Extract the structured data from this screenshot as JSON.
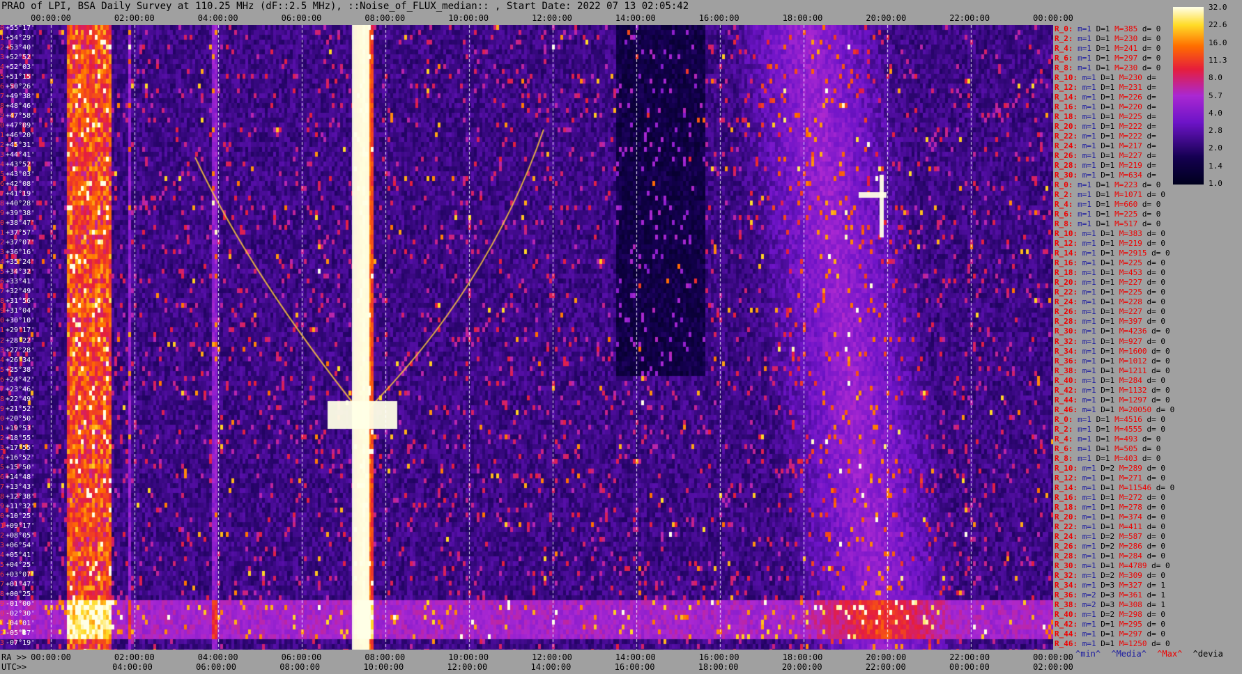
{
  "header": {
    "title": "PRAO of LPI, BSA Daily Survey at 110.25 MHz (dF::2.5 MHz), ::Noise_of_FLUX_median:: , Start Date: 2022 07 13 02:05:42"
  },
  "top_axis": {
    "labels": [
      "00:00:00",
      "02:00:00",
      "04:00:00",
      "06:00:00",
      "08:00:00",
      "10:00:00",
      "12:00:00",
      "14:00:00",
      "16:00:00",
      "18:00:00",
      "20:00:00",
      "22:00:00",
      "00:00:00"
    ]
  },
  "bottom_axis": {
    "ra_prefix": "RA >>",
    "ra_labels": [
      "00:00:00",
      "02:00:00",
      "04:00:00",
      "06:00:00",
      "08:00:00",
      "10:00:00",
      "12:00:00",
      "14:00:00",
      "16:00:00",
      "18:00:00",
      "20:00:00",
      "22:00:00",
      "00:00:00"
    ],
    "utc_prefix": "UTC>>",
    "utc_labels": [
      "04:00:00",
      "06:00:00",
      "08:00:00",
      "10:00:00",
      "12:00:00",
      "14:00:00",
      "16:00:00",
      "18:00:00",
      "20:00:00",
      "22:00:00",
      "00:00:00",
      "02:00:00"
    ]
  },
  "declination_labels": [
    "+55°17'",
    "+54°29'",
    "+53°40'",
    "+52°52'",
    "+52°03'",
    "+51°15'",
    "+50°26'",
    "+49°38'",
    "+48°46'",
    "+47°58'",
    "+47°09'",
    "+46°20'",
    "+45°31'",
    "+44°41'",
    "+43°52'",
    "+43°03'",
    "+42°08'",
    "+41°19'",
    "+40°28'",
    "+39°38'",
    "+38°47'",
    "+37°57'",
    "+37°07'",
    "+36°16'",
    "+35°24'",
    "+34°32'",
    "+33°41'",
    "+32°49'",
    "+31°56'",
    "+31°04'",
    "+30°10'",
    "+29°17'",
    "+28°22'",
    "+27°28'",
    "+26°34'",
    "+25°38'",
    "+24°42'",
    "+23°46'",
    "+22°49'",
    "+21°52'",
    "+20°50'",
    "+19°53'",
    "+18°55'",
    "+17°55'",
    "+16°52'",
    "+15°50'",
    "+14°48'",
    "+13°43'",
    "+12°38'",
    "+11°32'",
    "+10°25'",
    "+09°17'",
    "+08°05'",
    "+06°54'",
    "+05°41'",
    "+04°25'",
    "+03°07'",
    "+01°47'",
    "+00°25'",
    "-01°00'",
    "-02°30'",
    "-04°01'",
    "-05°37'",
    "-07°19'"
  ],
  "side_stats": [
    {
      "r": "R_0:",
      "m": "m=1",
      "d": "D=1",
      "M": "M=385",
      "dd": "d= 0"
    },
    {
      "r": "R_2:",
      "m": "m=1",
      "d": "D=1",
      "M": "M=230",
      "dd": "d= 0"
    },
    {
      "r": "R_4:",
      "m": "m=1",
      "d": "D=1",
      "M": "M=241",
      "dd": "d= 0"
    },
    {
      "r": "R_6:",
      "m": "m=1",
      "d": "D=1",
      "M": "M=297",
      "dd": "d= 0"
    },
    {
      "r": "R_8:",
      "m": "m=1",
      "d": "D=1",
      "M": "M=230",
      "dd": "d= 0"
    },
    {
      "r": "R_10:",
      "m": "m=1",
      "d": "D=1",
      "M": "M=230",
      "dd": "d="
    },
    {
      "r": "R_12:",
      "m": "m=1",
      "d": "D=1",
      "M": "M=231",
      "dd": "d="
    },
    {
      "r": "R_14:",
      "m": "m=1",
      "d": "D=1",
      "M": "M=226",
      "dd": "d="
    },
    {
      "r": "R_16:",
      "m": "m=1",
      "d": "D=1",
      "M": "M=220",
      "dd": "d="
    },
    {
      "r": "R_18:",
      "m": "m=1",
      "d": "D=1",
      "M": "M=225",
      "dd": "d="
    },
    {
      "r": "R_20:",
      "m": "m=1",
      "d": "D=1",
      "M": "M=222",
      "dd": "d="
    },
    {
      "r": "R_22:",
      "m": "m=1",
      "d": "D=1",
      "M": "M=222",
      "dd": "d="
    },
    {
      "r": "R_24:",
      "m": "m=1",
      "d": "D=1",
      "M": "M=217",
      "dd": "d="
    },
    {
      "r": "R_26:",
      "m": "m=1",
      "d": "D=1",
      "M": "M=227",
      "dd": "d="
    },
    {
      "r": "R_28:",
      "m": "m=1",
      "d": "D=1",
      "M": "M=219",
      "dd": "d="
    },
    {
      "r": "R_30:",
      "m": "m=1",
      "d": "D=1",
      "M": "M=634",
      "dd": "d="
    },
    {
      "r": "R_0:",
      "m": "m=1",
      "d": "D=1",
      "M": "M=223",
      "dd": "d= 0"
    },
    {
      "r": "R_2:",
      "m": "m=1",
      "d": "D=1",
      "M": "M=1071",
      "dd": "d= 0"
    },
    {
      "r": "R_4:",
      "m": "m=1",
      "d": "D=1",
      "M": "M=660",
      "dd": "d= 0"
    },
    {
      "r": "R_6:",
      "m": "m=1",
      "d": "D=1",
      "M": "M=225",
      "dd": "d= 0"
    },
    {
      "r": "R_8:",
      "m": "m=1",
      "d": "D=1",
      "M": "M=517",
      "dd": "d= 0"
    },
    {
      "r": "R_10:",
      "m": "m=1",
      "d": "D=1",
      "M": "M=383",
      "dd": "d= 0"
    },
    {
      "r": "R_12:",
      "m": "m=1",
      "d": "D=1",
      "M": "M=219",
      "dd": "d= 0"
    },
    {
      "r": "R_14:",
      "m": "m=1",
      "d": "D=1",
      "M": "M=2915",
      "dd": "d= 0"
    },
    {
      "r": "R_16:",
      "m": "m=1",
      "d": "D=1",
      "M": "M=225",
      "dd": "d= 0"
    },
    {
      "r": "R_18:",
      "m": "m=1",
      "d": "D=1",
      "M": "M=453",
      "dd": "d= 0"
    },
    {
      "r": "R_20:",
      "m": "m=1",
      "d": "D=1",
      "M": "M=227",
      "dd": "d= 0"
    },
    {
      "r": "R_22:",
      "m": "m=1",
      "d": "D=1",
      "M": "M=225",
      "dd": "d= 0"
    },
    {
      "r": "R_24:",
      "m": "m=1",
      "d": "D=1",
      "M": "M=228",
      "dd": "d= 0"
    },
    {
      "r": "R_26:",
      "m": "m=1",
      "d": "D=1",
      "M": "M=227",
      "dd": "d= 0"
    },
    {
      "r": "R_28:",
      "m": "m=1",
      "d": "D=1",
      "M": "M=397",
      "dd": "d= 0"
    },
    {
      "r": "R_30:",
      "m": "m=1",
      "d": "D=1",
      "M": "M=4236",
      "dd": "d= 0"
    },
    {
      "r": "R_32:",
      "m": "m=1",
      "d": "D=1",
      "M": "M=927",
      "dd": "d= 0"
    },
    {
      "r": "R_34:",
      "m": "m=1",
      "d": "D=1",
      "M": "M=1600",
      "dd": "d= 0"
    },
    {
      "r": "R_36:",
      "m": "m=1",
      "d": "D=1",
      "M": "M=1012",
      "dd": "d= 0"
    },
    {
      "r": "R_38:",
      "m": "m=1",
      "d": "D=1",
      "M": "M=1211",
      "dd": "d= 0"
    },
    {
      "r": "R_40:",
      "m": "m=1",
      "d": "D=1",
      "M": "M=284",
      "dd": "d= 0"
    },
    {
      "r": "R_42:",
      "m": "m=1",
      "d": "D=1",
      "M": "M=1132",
      "dd": "d= 0"
    },
    {
      "r": "R_44:",
      "m": "m=1",
      "d": "D=1",
      "M": "M=1297",
      "dd": "d= 0"
    },
    {
      "r": "R_46:",
      "m": "m=1",
      "d": "D=1",
      "M": "M=20050",
      "dd": "d= 0"
    },
    {
      "r": "R_0:",
      "m": "m=1",
      "d": "D=1",
      "M": "M=4516",
      "dd": "d= 0"
    },
    {
      "r": "R_2:",
      "m": "m=1",
      "d": "D=1",
      "M": "M=4555",
      "dd": "d= 0"
    },
    {
      "r": "R_4:",
      "m": "m=1",
      "d": "D=1",
      "M": "M=493",
      "dd": "d= 0"
    },
    {
      "r": "R_6:",
      "m": "m=1",
      "d": "D=1",
      "M": "M=505",
      "dd": "d= 0"
    },
    {
      "r": "R_8:",
      "m": "m=1",
      "d": "D=1",
      "M": "M=403",
      "dd": "d= 0"
    },
    {
      "r": "R_10:",
      "m": "m=1",
      "d": "D=2",
      "M": "M=289",
      "dd": "d= 0"
    },
    {
      "r": "R_12:",
      "m": "m=1",
      "d": "D=1",
      "M": "M=271",
      "dd": "d= 0"
    },
    {
      "r": "R_14:",
      "m": "m=1",
      "d": "D=1",
      "M": "M=11546",
      "dd": "d= 0"
    },
    {
      "r": "R_16:",
      "m": "m=1",
      "d": "D=1",
      "M": "M=272",
      "dd": "d= 0"
    },
    {
      "r": "R_18:",
      "m": "m=1",
      "d": "D=1",
      "M": "M=278",
      "dd": "d= 0"
    },
    {
      "r": "R_20:",
      "m": "m=1",
      "d": "D=1",
      "M": "M=374",
      "dd": "d= 0"
    },
    {
      "r": "R_22:",
      "m": "m=1",
      "d": "D=1",
      "M": "M=411",
      "dd": "d= 0"
    },
    {
      "r": "R_24:",
      "m": "m=1",
      "d": "D=2",
      "M": "M=587",
      "dd": "d= 0"
    },
    {
      "r": "R_26:",
      "m": "m=1",
      "d": "D=2",
      "M": "M=286",
      "dd": "d= 0"
    },
    {
      "r": "R_28:",
      "m": "m=1",
      "d": "D=1",
      "M": "M=284",
      "dd": "d= 0"
    },
    {
      "r": "R_30:",
      "m": "m=1",
      "d": "D=1",
      "M": "M=4789",
      "dd": "d= 0"
    },
    {
      "r": "R_32:",
      "m": "m=1",
      "d": "D=2",
      "M": "M=309",
      "dd": "d= 0"
    },
    {
      "r": "R_34:",
      "m": "m=1",
      "d": "D=3",
      "M": "M=327",
      "dd": "d= 1"
    },
    {
      "r": "R_36:",
      "m": "m=2",
      "d": "D=3",
      "M": "M=361",
      "dd": "d= 1"
    },
    {
      "r": "R_38:",
      "m": "m=2",
      "d": "D=3",
      "M": "M=308",
      "dd": "d= 1"
    },
    {
      "r": "R_40:",
      "m": "m=1",
      "d": "D=2",
      "M": "M=298",
      "dd": "d= 0"
    },
    {
      "r": "R_42:",
      "m": "m=1",
      "d": "D=1",
      "M": "M=295",
      "dd": "d= 0"
    },
    {
      "r": "R_44:",
      "m": "m=1",
      "d": "D=1",
      "M": "M=297",
      "dd": "d= 0"
    },
    {
      "r": "R_46:",
      "m": "m=1",
      "d": "D=1",
      "M": "M=1250",
      "dd": "d= 0"
    }
  ],
  "legend_footer": {
    "min": "^min^",
    "media": "^Media^",
    "max": "^Max^",
    "devia": "^devia"
  },
  "colorbar": {
    "ticks": [
      "32.0",
      "22.6",
      "16.0",
      "11.3",
      "8.0",
      "5.7",
      "4.0",
      "2.8",
      "2.0",
      "1.4",
      "1.0"
    ],
    "min": 1.0,
    "max": 32.0,
    "scale": "log"
  },
  "chart_data": {
    "type": "heatmap",
    "title": "PRAO of LPI, BSA Daily Survey at 110.25 MHz (dF::2.5 MHz), ::Noise_of_FLUX_median:: , Start Date: 2022 07 13 02:05:42",
    "x_axis_ra": [
      "00:00:00",
      "02:00:00",
      "04:00:00",
      "06:00:00",
      "08:00:00",
      "10:00:00",
      "12:00:00",
      "14:00:00",
      "16:00:00",
      "18:00:00",
      "20:00:00",
      "22:00:00",
      "00:00:00"
    ],
    "x_axis_utc": [
      "04:00:00",
      "06:00:00",
      "08:00:00",
      "10:00:00",
      "12:00:00",
      "14:00:00",
      "16:00:00",
      "18:00:00",
      "20:00:00",
      "22:00:00",
      "00:00:00",
      "02:00:00"
    ],
    "y_range_dec": [
      "+55°17'",
      "-07°19'"
    ],
    "colorscale_range": [
      1.0,
      32.0
    ],
    "colorscale": "log"
  },
  "colors": {
    "background": "#a0a0a0",
    "low": "#000022",
    "mid": "#8a2be2",
    "high": "#ff2020",
    "peak": "#ffffcc"
  }
}
